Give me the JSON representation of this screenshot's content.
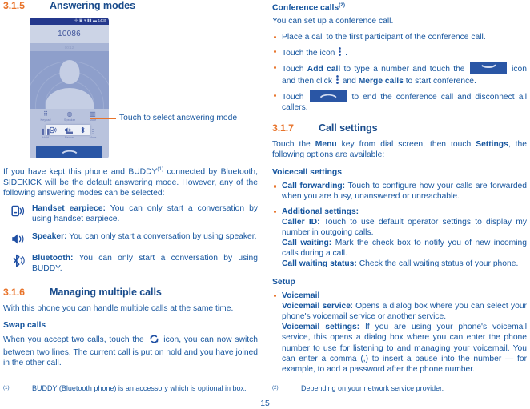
{
  "page": {
    "number": "15",
    "accent_orange": "#e8732a",
    "text_blue": "#16559e",
    "chip_blue": "#2a56a5"
  },
  "left": {
    "section1": {
      "num": "3.1.5",
      "title": "Answering modes"
    },
    "figure": {
      "phone_number": "10086",
      "status_time": "14:35",
      "sub_state": "00:12",
      "controls": [
        {
          "label": "Keypad",
          "icon": "keypad-icon"
        },
        {
          "label": "Speaker",
          "icon": "answering-mode-icon"
        },
        {
          "label": "Mute",
          "icon": "mute-icon"
        },
        {
          "label": "Hold",
          "icon": "hold-icon"
        },
        {
          "label": "Record",
          "icon": "record-icon"
        },
        {
          "label": "More",
          "icon": "more-vertical-icon"
        }
      ],
      "popup_icons": [
        "handset-earpiece-icon",
        "speaker-icon",
        "bluetooth-icon"
      ],
      "end_call_icon": "hangup-icon",
      "callout": "Touch to select answering mode"
    },
    "intro": {
      "part1": "If you have kept this phone and BUDDY",
      "footnote_mark": "(1)",
      "part2": " connected by Bluetooth, SIDEKICK will be the default answering mode. However, any of the following answering modes can be selected:"
    },
    "modes": [
      {
        "icon": "handset-earpiece-icon",
        "term": "Handset  earpiece:",
        "desc": " You can only start a conversation by using handset earpiece."
      },
      {
        "icon": "speaker-icon",
        "term": "Speaker:",
        "desc": " You can only start a conversation by using speaker."
      },
      {
        "icon": "bluetooth-icon",
        "term": "Bluetooth:",
        "desc": " You can only start a conversation by using BUDDY."
      }
    ],
    "section2": {
      "num": "3.1.6",
      "title": "Managing multiple calls",
      "intro": "With this phone you can handle multiple calls at the same time.",
      "sub_title": "Swap calls",
      "body_part1": "When you accept two calls, touch the ",
      "body_icon": "swap-calls-icon",
      "body_part2": " icon, you can now switch between two lines. The current call is put on hold and you have joined in the other call."
    },
    "footnote": {
      "mark": "(1)",
      "text": "BUDDY (Bluetooth phone) is an accessory which is optional in box."
    }
  },
  "right": {
    "conference": {
      "title": "Conference calls",
      "title_mark": "(2)",
      "intro": "You can set up a conference call.",
      "bullets": [
        {
          "parts": [
            {
              "t": "Place a call to the first participant of the conference call.",
              "b": false
            }
          ]
        },
        {
          "parts": [
            {
              "t": "Touch the icon ",
              "b": false
            },
            {
              "t": "__DOTS__",
              "b": false
            },
            {
              "t": " .",
              "b": false
            }
          ]
        },
        {
          "parts": [
            {
              "t": "Touch ",
              "b": false
            },
            {
              "t": "Add call",
              "b": true
            },
            {
              "t": " to type a number and touch the ",
              "b": false
            },
            {
              "t": "__CHIP_CALL__",
              "b": false
            },
            {
              "t": " icon and then click ",
              "b": false
            },
            {
              "t": "__DOTS__",
              "b": false
            },
            {
              "t": " and ",
              "b": false
            },
            {
              "t": "Merge calls",
              "b": true
            },
            {
              "t": " to start conference.",
              "b": false
            }
          ]
        },
        {
          "parts": [
            {
              "t": "Touch ",
              "b": false
            },
            {
              "t": "__CHIP_HANGUP__",
              "b": false
            },
            {
              "t": " to end the conference call and disconnect all callers.",
              "b": false
            }
          ]
        }
      ]
    },
    "section3": {
      "num": "3.1.7",
      "title": "Call settings",
      "intro_part1": "Touch the ",
      "intro_menu": "Menu",
      "intro_part2": " key from dial screen, then touch ",
      "intro_settings": "Settings",
      "intro_part3": ", the following options are available:"
    },
    "voicecall": {
      "heading": "Voicecall settings",
      "items": [
        {
          "term": "Call forwarding:",
          "desc": " Touch to configure how your calls are forwarded when you are busy, unanswered or unreachable."
        },
        {
          "term": "Additional settings:",
          "desc": "",
          "subitems": [
            {
              "term": "Caller ID:",
              "desc": " Touch to use default operator settings to display my number in outgoing calls."
            },
            {
              "term": "Call waiting:",
              "desc": " Mark the check box to notify you of new incoming calls during a call."
            },
            {
              "term": "Call waiting status:",
              "desc": " Check the call waiting status of your phone."
            }
          ]
        }
      ]
    },
    "setup": {
      "heading": "Setup",
      "items": [
        {
          "term": "Voicemail",
          "desc": "",
          "subitems": [
            {
              "term": "Voicemail service",
              "desc": ": Opens a dialog box where you can select your phone's voicemail service or another service."
            },
            {
              "term": "Voicemail settings:",
              "desc": " If you are using your phone's voicemail service, this opens a dialog box where you can enter the phone number to use for listening to and managing your voicemail. You can enter a comma (,) to insert a pause into the number — for example, to add a password after the phone number."
            }
          ]
        }
      ]
    },
    "footnote": {
      "mark": "(2)",
      "text": "Depending on your network service provider."
    }
  }
}
